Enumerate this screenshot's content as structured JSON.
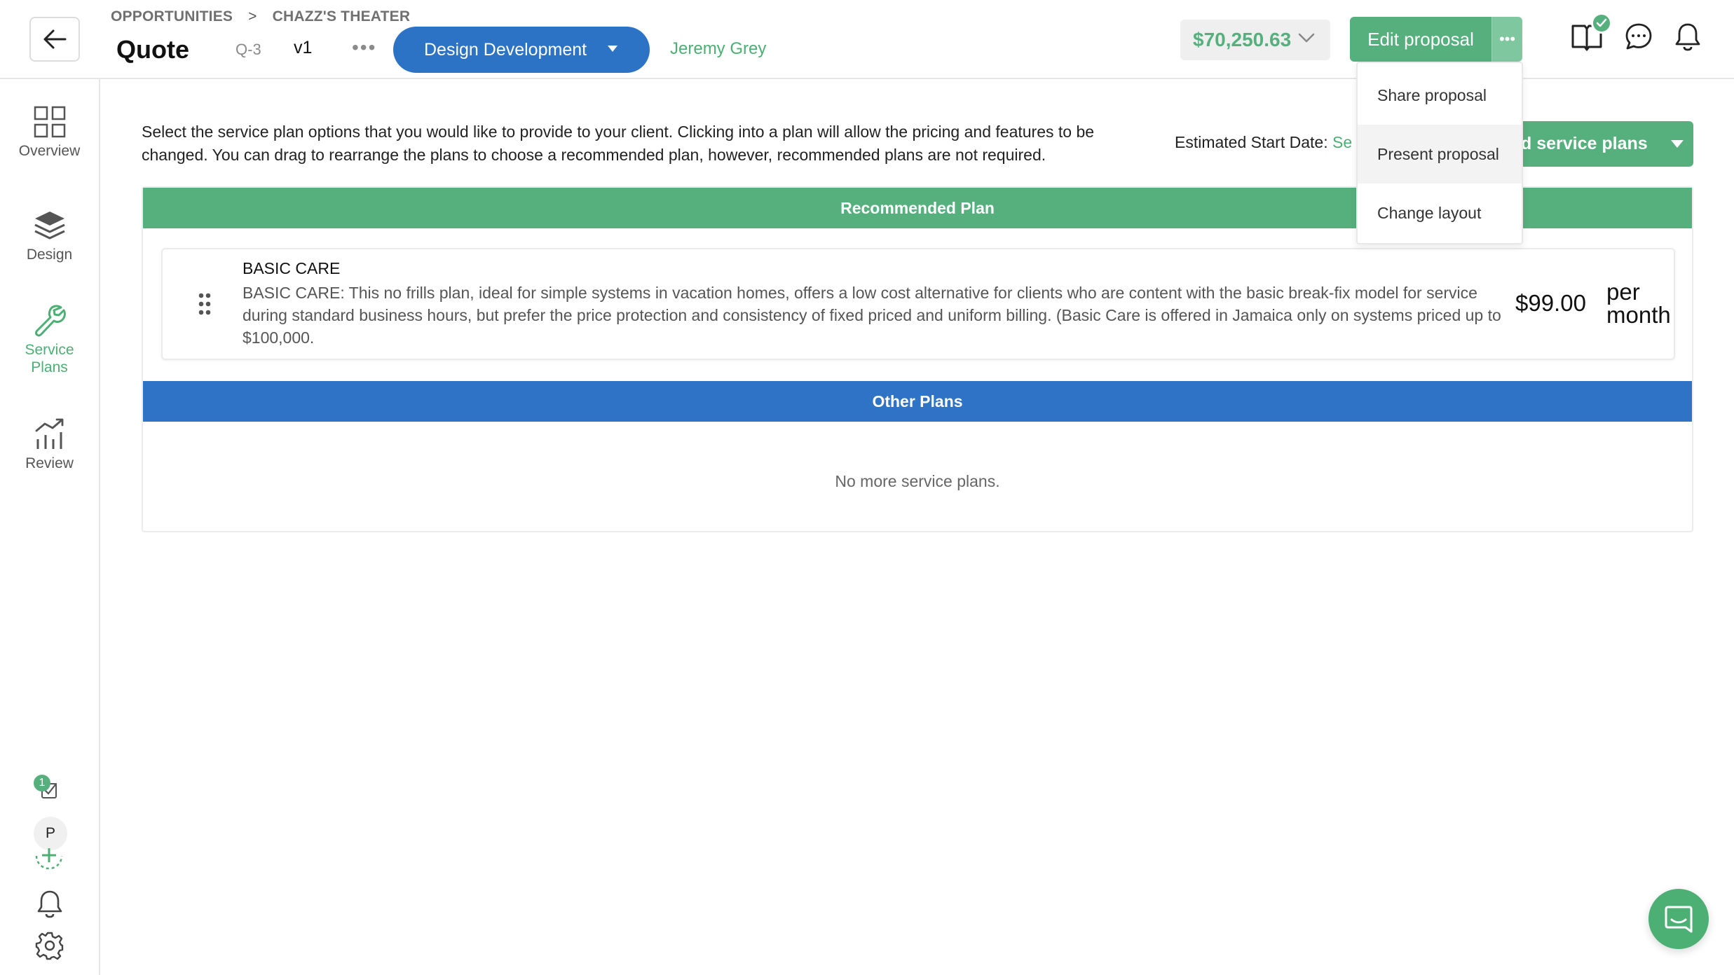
{
  "header": {
    "breadcrumb": [
      "OPPORTUNITIES",
      "CHAZZ'S THEATER"
    ],
    "breadcrumb_separator": ">",
    "title": "Quote",
    "quote_id": "Q-3",
    "version": "v1",
    "more": "•••",
    "stage": "Design Development",
    "owner": "Jeremy Grey",
    "total": "$70,250.63",
    "edit_button": "Edit proposal",
    "edit_more": "•••"
  },
  "dropdown": {
    "items": [
      {
        "label": "Share proposal"
      },
      {
        "label": "Present proposal"
      },
      {
        "label": "Change layout"
      }
    ]
  },
  "sidebar": {
    "items": [
      {
        "label": "Overview",
        "icon": "grid-icon"
      },
      {
        "label": "Design",
        "icon": "layers-icon"
      },
      {
        "label": "Service Plans",
        "icon": "wrench-icon"
      },
      {
        "label": "Review",
        "icon": "chart-icon"
      }
    ],
    "task_count": "1",
    "avatar_initial": "P"
  },
  "main": {
    "intro": "Select the service plan options that you would like to provide to your client. Clicking into a plan will allow the pricing and features to be changed. You can drag to rearrange the plans to choose a recommended plan, however, recommended plans are not required.",
    "estimated_start_label": "Estimated Start Date: ",
    "estimated_start_link": "Se",
    "add_plans_button": "d service plans",
    "recommended_header": "Recommended Plan",
    "other_header": "Other Plans",
    "empty_message": "No more service plans.",
    "plan": {
      "name": "BASIC CARE",
      "description": "BASIC CARE: This no frills plan, ideal for simple systems in vacation homes, offers a low cost alternative for clients who are content with the basic break-fix model for service during standard business hours, but prefer the price protection and consistency of fixed priced and uniform billing. (Basic Care is offered in Jamaica only on systems priced up to $100,000.",
      "price": "$99.00",
      "period_line1": "per",
      "period_line2": "month"
    }
  },
  "colors": {
    "green": "#55b07d",
    "blue": "#2f73c6",
    "link_green": "#4caf73"
  }
}
